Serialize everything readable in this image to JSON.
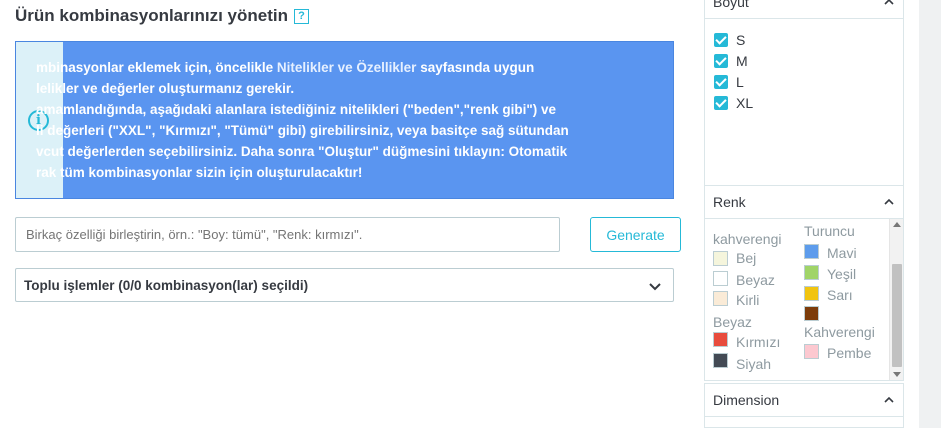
{
  "page": {
    "title": "Ürün kombinasyonlarınızı yönetin",
    "help_glyph": "?"
  },
  "info": {
    "icon": "i",
    "l1_a": "mbinasyonlar eklemek için, öncelikle ",
    "l1_link": "Nitelikler ve Özellikler",
    "l1_b": " sayfasında uygun",
    "l2": "lelikler ve değerler oluşturmanız gerekir.",
    "l3": "amamlandığında, aşağıdaki alanlara istediğiniz nitelikleri (\"beden\",\"renk gibi\") ve",
    "l4": "li değerleri (\"XXL\", \"Kırmızı\", \"Tümü\" gibi) girebilirsiniz, veya basitçe sağ sütundan",
    "l5": "vcut değerlerden seçebilirsiniz. Daha sonra \"Oluştur\" düğmesini tıklayın: Otomatik",
    "l6": "rak tüm kombinasyonlar sizin için oluşturulacaktır!"
  },
  "combo_input": {
    "placeholder": "Birkaç özelliği birleştirin, örn.: \"Boy: tümü\", \"Renk: kırmızı\"."
  },
  "generate_label": "Generate",
  "bulk": {
    "label": "Toplu işlemler (0/0 kombinasyon(lar) seçildi)"
  },
  "sidebar": {
    "boyut": {
      "title": "Boyut",
      "items": [
        "S",
        "M",
        "L",
        "XL"
      ]
    },
    "renk": {
      "title": "Renk",
      "left_group_top": "kahverengi",
      "right_group_top": "Turuncu",
      "left": [
        {
          "name": "Bej",
          "color": "#f5f5dc"
        },
        {
          "name": "Beyaz",
          "color": "#ffffff"
        },
        {
          "name": "Kirli",
          "color": "#faebd7"
        }
      ],
      "left_group_mid": "Beyaz",
      "left2": [
        {
          "name": "Kırmızı",
          "color": "#e84c3d"
        },
        {
          "name": "Siyah",
          "color": "#434a54"
        }
      ],
      "right": [
        {
          "name": "Mavi",
          "color": "#5d9cec"
        },
        {
          "name": "Yeşil",
          "color": "#a0d468"
        },
        {
          "name": "Sarı",
          "color": "#f1c40f"
        },
        {
          "name": "",
          "color": "#7d3c0a"
        }
      ],
      "right_group_mid": "Kahverengi",
      "right2": [
        {
          "name": "Pembe",
          "color": "#fcc8d0"
        }
      ]
    },
    "dimension": {
      "title": "Dimension"
    }
  }
}
